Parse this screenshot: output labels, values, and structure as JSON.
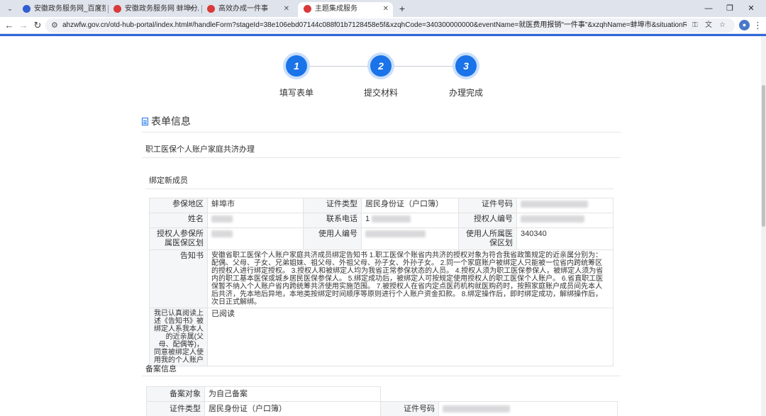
{
  "browser": {
    "tabs": [
      {
        "title": "安徽政务服务网_百度搜索",
        "active": false,
        "favicon": "blue"
      },
      {
        "title": "安徽政务服务网 蚌埠分厅",
        "active": false,
        "favicon": "red"
      },
      {
        "title": "高效办成一件事",
        "active": false,
        "favicon": "red"
      },
      {
        "title": "主题集成服务",
        "active": true,
        "favicon": "red"
      }
    ],
    "url": "ahzwfw.gov.cn/otd-hub-portal/index.html#/handleForm?stageId=38e106ebd07144c088f01b7128458e5f&xzqhCode=340300000000&eventName=就医费用报销\"一件事\"&xzqhName=蚌埠市&situationResultId=de8a909b098b425c900..."
  },
  "steps": [
    {
      "num": "1",
      "label": "填写表单"
    },
    {
      "num": "2",
      "label": "提交材料"
    },
    {
      "num": "3",
      "label": "办理完成"
    }
  ],
  "form": {
    "section_title": "表单信息",
    "item_name": "职工医保个人账户家庭共济办理",
    "bind_group_title": "绑定新成员",
    "labels": {
      "area": "参保地区",
      "id_type": "证件类型",
      "id_number": "证件号码",
      "name": "姓名",
      "phone": "联系电话",
      "grantor_id": "授权人编号",
      "grantor_area": "授权人参保所属医保区划",
      "user_id": "使用人编号",
      "user_area": "使用人所属医保区划",
      "notice": "告知书",
      "confirm": "我已认真阅读上述《告知书》被绑定人系我本人的近亲属(父母、配偶等)，同意被绑定人使用我的个人账户"
    },
    "values": {
      "area": "蚌埠市",
      "id_type": "居民身份证（户口簿）",
      "phone_prefix": "1",
      "user_area": "340340",
      "notice": "安徽省职工医保个人账户家庭共济成员绑定告知书 1.职工医保个账省内共济的授权对象为符合我省政策规定的近亲属分别为：配偶、父母、子女、兄弟姐妹、祖父母、外祖父母、孙子女、外孙子女。 2.同一个家庭账户被绑定人只能被一位省内跨统筹区的授权人进行绑定授权。 3.授权人和被绑定人均为我省正常参保状态的人员。 4.授权人须为职工医保参保人，被绑定人须为省内的职工基本医保或城乡居民医保参保人。 5.绑定成功后，被绑定人可按规定使用授权人的职工医保个人账户。 6.省直职工医保暂不纳入个人账户省内跨统筹共济使用实施范围。 7.被授权人在省内定点医药机构就医购药时，按照家庭账户成员间先本人后共济，先本地后异地，本地类按绑定时间顺序等原则进行个人账户资金扣款。 8.绑定操作后，即时绑定成功，解绑操作后，次日正式解绑。",
      "confirm": "已阅读"
    },
    "filing_title": "备案信息",
    "filing_labels": {
      "target": "备案对象",
      "id_type": "证件类型",
      "id_number": "证件号码"
    },
    "filing_values": {
      "target": "为自己备案",
      "id_type": "居民身份证（户口簿）"
    }
  }
}
